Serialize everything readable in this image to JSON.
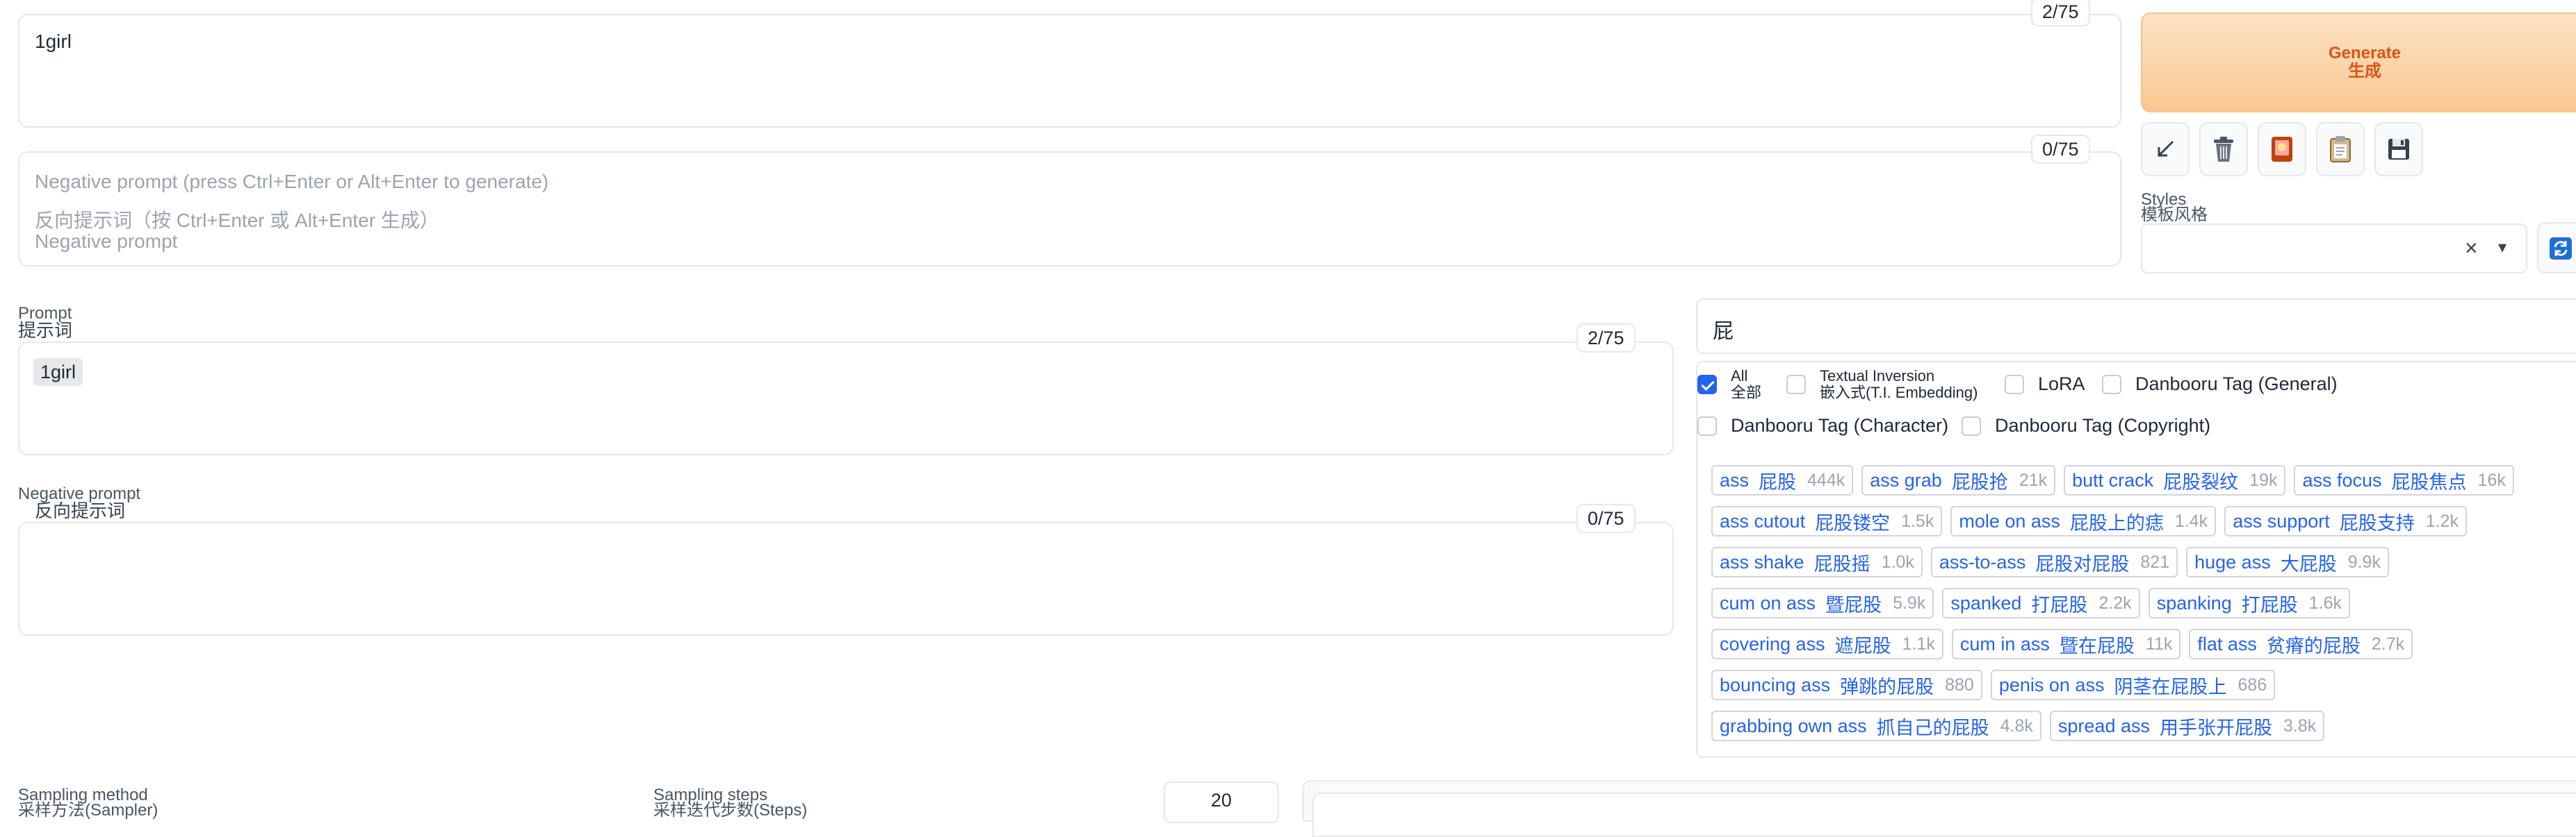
{
  "top": {
    "prompt_value": "1girl",
    "prompt_counter": "2/75",
    "negative_placeholder_en": "Negative prompt (press Ctrl+Enter or Alt+Enter to generate)",
    "negative_placeholder_zh": "反向提示词（按 Ctrl+Enter 或 Alt+Enter 生成）",
    "negative_placeholder_en2": "Negative prompt",
    "negative_counter": "0/75"
  },
  "generate": {
    "label_en": "Generate",
    "label_zh": "生成"
  },
  "tools": [
    "arrow-icon",
    "trash-icon",
    "card-icon",
    "clipboard-icon",
    "save-icon"
  ],
  "styles": {
    "label_en": "Styles",
    "label_zh": "模板风格",
    "clear": "×",
    "dropdown": "▾"
  },
  "editor": {
    "prompt_label_en": "Prompt",
    "prompt_label_zh": "提示词",
    "prompt_counter": "2/75",
    "prompt_token": "1girl",
    "negative_label_en": "Negative prompt",
    "negative_label_zh": "反向提示词",
    "negative_counter": "0/75"
  },
  "search": {
    "query": "屁",
    "filters": [
      {
        "en": "All",
        "zh": "全部",
        "checked": true
      },
      {
        "en": "Textual Inversion",
        "zh": "嵌入式(T.I. Embedding)",
        "checked": false
      },
      {
        "en": "LoRA",
        "zh": "",
        "checked": false
      },
      {
        "en": "Danbooru Tag (General)",
        "zh": "",
        "checked": false
      },
      {
        "en": "Danbooru Tag (Character)",
        "zh": "",
        "checked": false
      },
      {
        "en": "Danbooru Tag (Copyright)",
        "zh": "",
        "checked": false
      }
    ],
    "tags": [
      [
        [
          "ass",
          "屁股",
          "444k"
        ],
        [
          "ass grab",
          "屁股抢",
          "21k"
        ],
        [
          "butt crack",
          "屁股裂纹",
          "19k"
        ],
        [
          "ass focus",
          "屁股焦点",
          "16k"
        ]
      ],
      [
        [
          "ass cutout",
          "屁股镂空",
          "1.5k"
        ],
        [
          "mole on ass",
          "屁股上的痣",
          "1.4k"
        ],
        [
          "ass support",
          "屁股支持",
          "1.2k"
        ]
      ],
      [
        [
          "ass shake",
          "屁股摇",
          "1.0k"
        ],
        [
          "ass-to-ass",
          "屁股对屁股",
          "821"
        ],
        [
          "huge ass",
          "大屁股",
          "9.9k"
        ]
      ],
      [
        [
          "cum on ass",
          "暨屁股",
          "5.9k"
        ],
        [
          "spanked",
          "打屁股",
          "2.2k"
        ],
        [
          "spanking",
          "打屁股",
          "1.6k"
        ]
      ],
      [
        [
          "covering ass",
          "遮屁股",
          "1.1k"
        ],
        [
          "cum in ass",
          "暨在屁股",
          "11k"
        ],
        [
          "flat ass",
          "贫瘠的屁股",
          "2.7k"
        ]
      ],
      [
        [
          "bouncing ass",
          "弹跳的屁股",
          "880"
        ],
        [
          "penis on ass",
          "阴茎在屁股上",
          "686"
        ]
      ],
      [
        [
          "grabbing own ass",
          "抓自己的屁股",
          "4.8k"
        ],
        [
          "spread ass",
          "用手张开屁股",
          "3.8k"
        ]
      ]
    ]
  },
  "sampling": {
    "method_label_en": "Sampling method",
    "method_label_zh": "采样方法(Sampler)",
    "steps_label_en": "Sampling steps",
    "steps_label_zh": "采样迭代步数(Steps)",
    "steps_value": "20"
  }
}
